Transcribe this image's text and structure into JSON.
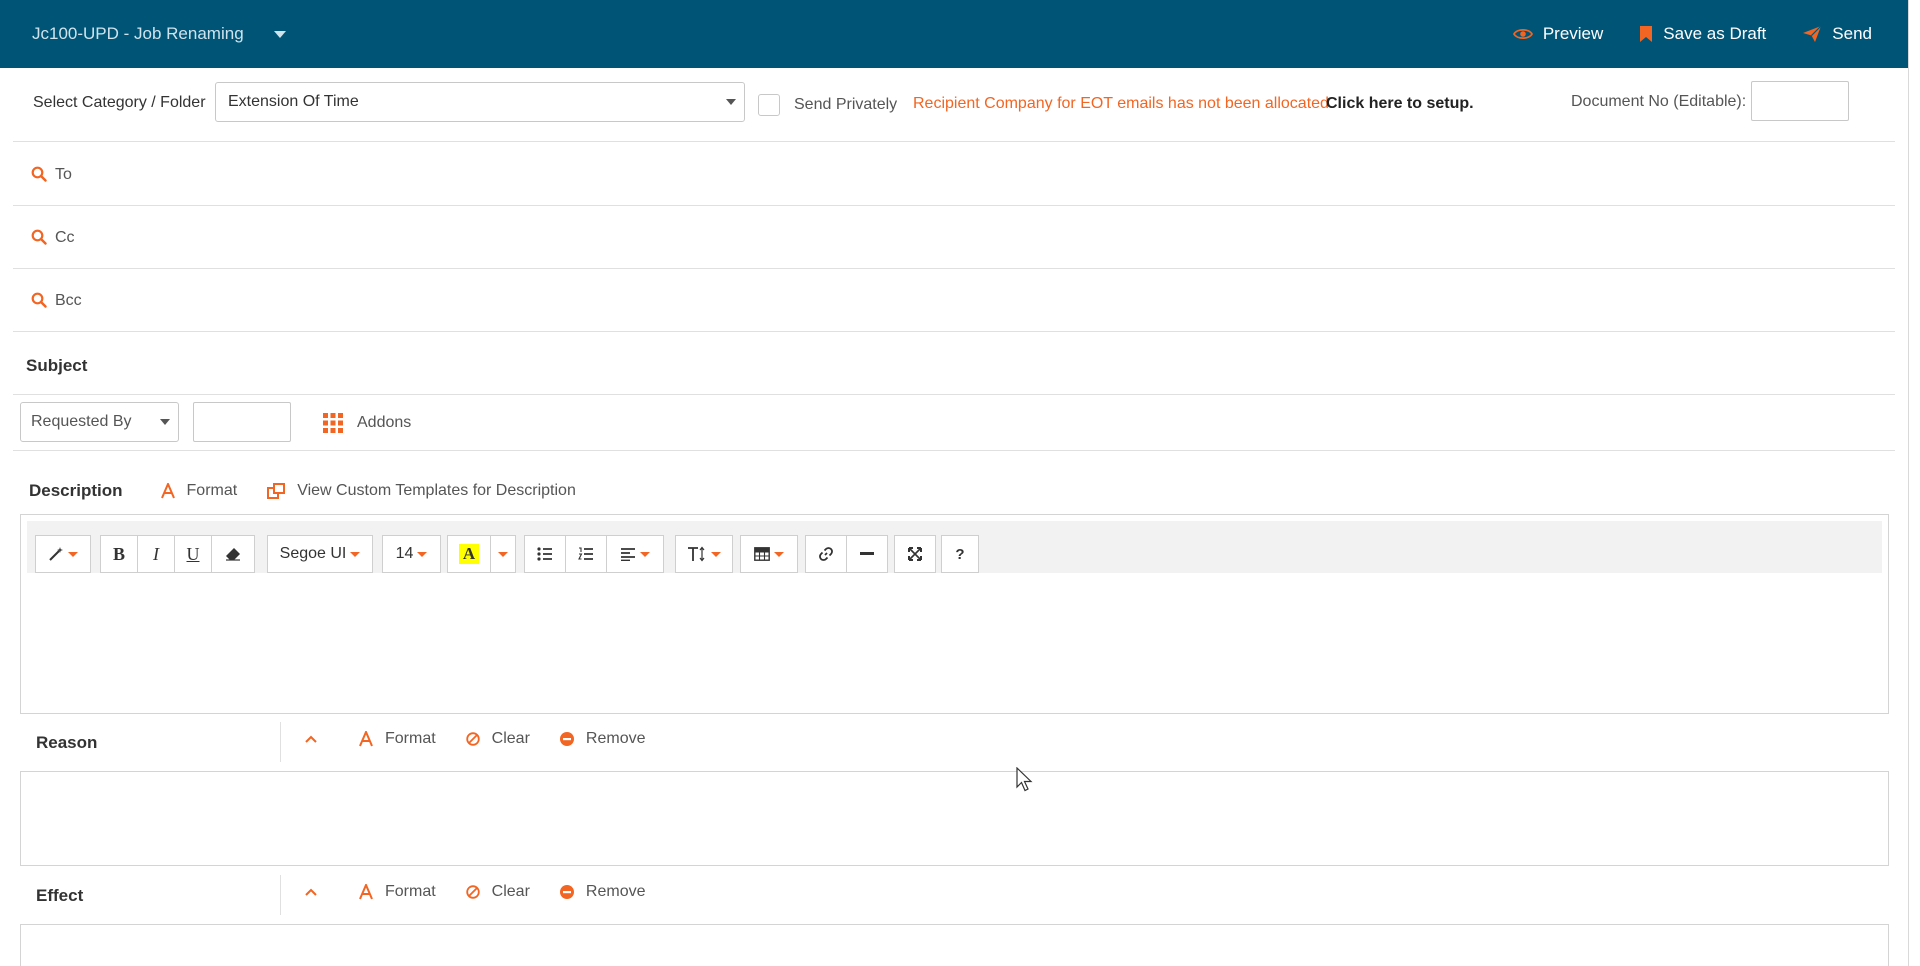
{
  "header": {
    "title": "Jc100-UPD - Job Renaming",
    "actions": {
      "preview": "Preview",
      "save_draft": "Save as Draft",
      "send": "Send"
    }
  },
  "category": {
    "label": "Select Category / Folder",
    "selected": "Extension Of Time",
    "send_privately": "Send Privately",
    "warning": "Recipient Company for EOT emails has not been allocated.",
    "setup_link": "Click here to setup.",
    "docno_label": "Document No (Editable):",
    "docno_value": ""
  },
  "recipients": {
    "to": "To",
    "cc": "Cc",
    "bcc": "Bcc"
  },
  "subject": {
    "label": "Subject"
  },
  "request": {
    "selected": "Requested By",
    "value": "",
    "addons": "Addons"
  },
  "description": {
    "label": "Description",
    "format": "Format",
    "templates": "View Custom Templates for Description",
    "toolbar": {
      "font": "Segoe UI",
      "size": "14",
      "bold": "B",
      "italic": "I",
      "underline": "U",
      "help": "?"
    }
  },
  "reason": {
    "label": "Reason",
    "format": "Format",
    "clear": "Clear",
    "remove": "Remove"
  },
  "effect": {
    "label": "Effect",
    "format": "Format",
    "clear": "Clear",
    "remove": "Remove"
  },
  "colors": {
    "header_bg": "#005577",
    "accent": "#f26522"
  }
}
